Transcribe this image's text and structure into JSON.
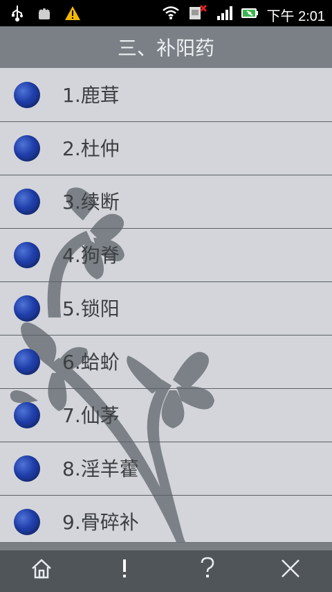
{
  "status_bar": {
    "time": "下午 2:01",
    "icons": [
      "usb-icon",
      "android-debug-icon",
      "warning-icon",
      "wifi-icon",
      "sim-error-icon",
      "signal-icon",
      "battery-icon"
    ]
  },
  "title": "三、补阳药",
  "list": [
    {
      "label": "1.鹿茸"
    },
    {
      "label": "2.杜仲"
    },
    {
      "label": "3.续断"
    },
    {
      "label": "4.狗脊"
    },
    {
      "label": "5.锁阳"
    },
    {
      "label": "6.蛤蚧"
    },
    {
      "label": "7.仙茅"
    },
    {
      "label": "8.淫羊藿"
    },
    {
      "label": "9.骨碎补"
    }
  ],
  "bottom_nav": [
    {
      "name": "home-icon"
    },
    {
      "name": "exclamation-icon"
    },
    {
      "name": "question-icon"
    },
    {
      "name": "close-icon"
    }
  ]
}
